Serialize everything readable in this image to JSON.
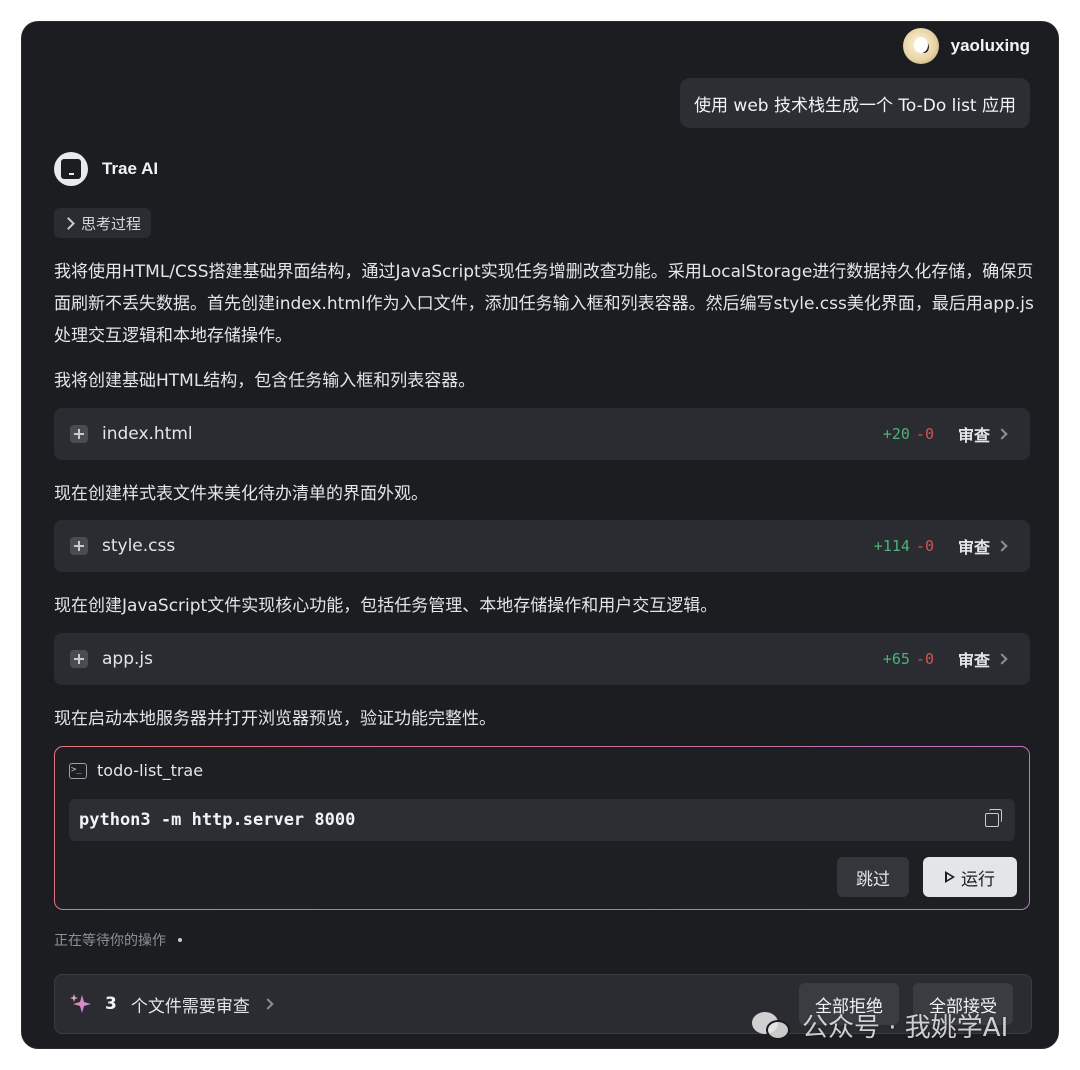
{
  "user": {
    "name": "yaoluxing",
    "message": "使用 web 技术栈生成一个 To-Do list 应用"
  },
  "ai": {
    "name": "Trae AI",
    "thinking_label": "思考过程"
  },
  "paragraphs": [
    "我将使用HTML/CSS搭建基础界面结构，通过JavaScript实现任务增删改查功能。采用LocalStorage进行数据持久化存储，确保页面刷新不丢失数据。首先创建index.html作为入口文件，添加任务输入框和列表容器。然后编写style.css美化界面，最后用app.js处理交互逻辑和本地存储操作。",
    "我将创建基础HTML结构，包含任务输入框和列表容器。",
    "现在创建样式表文件来美化待办清单的界面外观。",
    "现在创建JavaScript文件实现核心功能，包括任务管理、本地存储操作和用户交互逻辑。",
    "现在启动本地服务器并打开浏览器预览，验证功能完整性。"
  ],
  "files": [
    {
      "name": "index.html",
      "added": "+20",
      "removed": "-0",
      "review_label": "审查"
    },
    {
      "name": "style.css",
      "added": "+114",
      "removed": "-0",
      "review_label": "审查"
    },
    {
      "name": "app.js",
      "added": "+65",
      "removed": "-0",
      "review_label": "审查"
    }
  ],
  "terminal": {
    "name": "todo-list_trae",
    "command": "python3 -m http.server 8000",
    "skip_label": "跳过",
    "run_label": "运行"
  },
  "status_text": "正在等待你的操作",
  "bottom_bar": {
    "count": "3",
    "text": "个文件需要审查",
    "reject_all": "全部拒绝",
    "accept_all": "全部接受"
  },
  "watermark": {
    "text": "公众号 · 我姚学AI"
  }
}
